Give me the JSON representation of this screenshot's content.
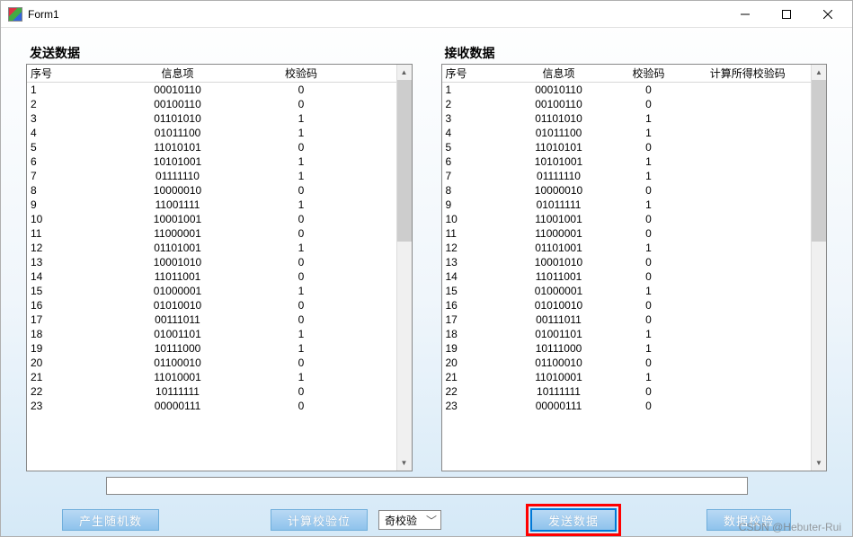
{
  "window": {
    "title": "Form1"
  },
  "labels": {
    "send": "发送数据",
    "recv": "接收数据"
  },
  "sendTable": {
    "headers": [
      "序号",
      "信息项",
      "校验码"
    ],
    "rows": [
      {
        "n": "1",
        "info": "00010110",
        "chk": "0"
      },
      {
        "n": "2",
        "info": "00100110",
        "chk": "0"
      },
      {
        "n": "3",
        "info": "01101010",
        "chk": "1"
      },
      {
        "n": "4",
        "info": "01011100",
        "chk": "1"
      },
      {
        "n": "5",
        "info": "11010101",
        "chk": "0"
      },
      {
        "n": "6",
        "info": "10101001",
        "chk": "1"
      },
      {
        "n": "7",
        "info": "01111110",
        "chk": "1"
      },
      {
        "n": "8",
        "info": "10000010",
        "chk": "0"
      },
      {
        "n": "9",
        "info": "11001111",
        "chk": "1"
      },
      {
        "n": "10",
        "info": "10001001",
        "chk": "0"
      },
      {
        "n": "11",
        "info": "11000001",
        "chk": "0"
      },
      {
        "n": "12",
        "info": "01101001",
        "chk": "1"
      },
      {
        "n": "13",
        "info": "10001010",
        "chk": "0"
      },
      {
        "n": "14",
        "info": "11011001",
        "chk": "0"
      },
      {
        "n": "15",
        "info": "01000001",
        "chk": "1"
      },
      {
        "n": "16",
        "info": "01010010",
        "chk": "0"
      },
      {
        "n": "17",
        "info": "00111011",
        "chk": "0"
      },
      {
        "n": "18",
        "info": "01001101",
        "chk": "1"
      },
      {
        "n": "19",
        "info": "10111000",
        "chk": "1"
      },
      {
        "n": "20",
        "info": "01100010",
        "chk": "0"
      },
      {
        "n": "21",
        "info": "11010001",
        "chk": "1"
      },
      {
        "n": "22",
        "info": "10111111",
        "chk": "0"
      },
      {
        "n": "23",
        "info": "00000111",
        "chk": "0"
      }
    ]
  },
  "recvTable": {
    "headers": [
      "序号",
      "信息项",
      "校验码",
      "计算所得校验码"
    ],
    "rows": [
      {
        "n": "1",
        "info": "00010110",
        "chk": "0",
        "calc": ""
      },
      {
        "n": "2",
        "info": "00100110",
        "chk": "0",
        "calc": ""
      },
      {
        "n": "3",
        "info": "01101010",
        "chk": "1",
        "calc": ""
      },
      {
        "n": "4",
        "info": "01011100",
        "chk": "1",
        "calc": ""
      },
      {
        "n": "5",
        "info": "11010101",
        "chk": "0",
        "calc": ""
      },
      {
        "n": "6",
        "info": "10101001",
        "chk": "1",
        "calc": ""
      },
      {
        "n": "7",
        "info": "01111110",
        "chk": "1",
        "calc": ""
      },
      {
        "n": "8",
        "info": "10000010",
        "chk": "0",
        "calc": ""
      },
      {
        "n": "9",
        "info": "01011111",
        "chk": "1",
        "calc": ""
      },
      {
        "n": "10",
        "info": "11001001",
        "chk": "0",
        "calc": ""
      },
      {
        "n": "11",
        "info": "11000001",
        "chk": "0",
        "calc": ""
      },
      {
        "n": "12",
        "info": "01101001",
        "chk": "1",
        "calc": ""
      },
      {
        "n": "13",
        "info": "10001010",
        "chk": "0",
        "calc": ""
      },
      {
        "n": "14",
        "info": "11011001",
        "chk": "0",
        "calc": ""
      },
      {
        "n": "15",
        "info": "01000001",
        "chk": "1",
        "calc": ""
      },
      {
        "n": "16",
        "info": "01010010",
        "chk": "0",
        "calc": ""
      },
      {
        "n": "17",
        "info": "00111011",
        "chk": "0",
        "calc": ""
      },
      {
        "n": "18",
        "info": "01001101",
        "chk": "1",
        "calc": ""
      },
      {
        "n": "19",
        "info": "10111000",
        "chk": "1",
        "calc": ""
      },
      {
        "n": "20",
        "info": "01100010",
        "chk": "0",
        "calc": ""
      },
      {
        "n": "21",
        "info": "11010001",
        "chk": "1",
        "calc": ""
      },
      {
        "n": "22",
        "info": "10111111",
        "chk": "0",
        "calc": ""
      },
      {
        "n": "23",
        "info": "00000111",
        "chk": "0",
        "calc": ""
      }
    ]
  },
  "textbox": {
    "value": ""
  },
  "buttons": {
    "genRandom": "产生随机数",
    "calcCheck": "计算校验位",
    "sendData": "发送数据",
    "dataCheck": "数据校验"
  },
  "combo": {
    "selected": "奇校验"
  },
  "watermark": "CSDN @Hebuter-Rui"
}
